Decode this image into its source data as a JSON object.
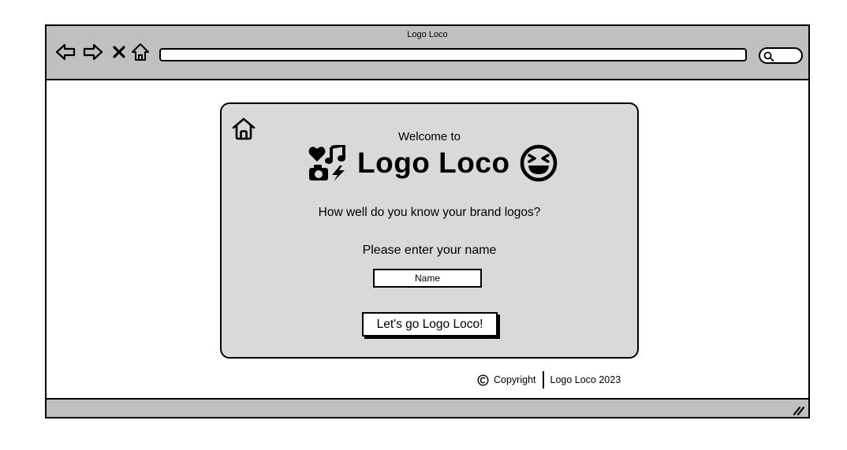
{
  "window": {
    "title": "Logo Loco",
    "address_value": "",
    "search_value": ""
  },
  "icons": {
    "back": "arrow-left-icon",
    "forward": "arrow-right-icon",
    "stop": "close-icon",
    "home": "home-icon",
    "search": "search-icon",
    "card_home": "home-icon",
    "brand_logo": "media-collage-icon",
    "brand_emoji": "laughing-face-icon",
    "copyright": "copyright-icon",
    "resize": "resize-grip-icon"
  },
  "card": {
    "welcome": "Welcome to",
    "brand_name": "Logo Loco",
    "tagline": "How well do you know your brand logos?",
    "prompt": "Please enter your name",
    "name_placeholder": "Name",
    "name_value": "",
    "start_button": "Let's go Logo Loco!"
  },
  "footer": {
    "copyright_label": "Copyright",
    "owner": "Logo Loco 2023"
  },
  "colors": {
    "frame": "#c0c0c0",
    "card": "#d9d9d9",
    "ink": "#000000",
    "page": "#ffffff"
  }
}
